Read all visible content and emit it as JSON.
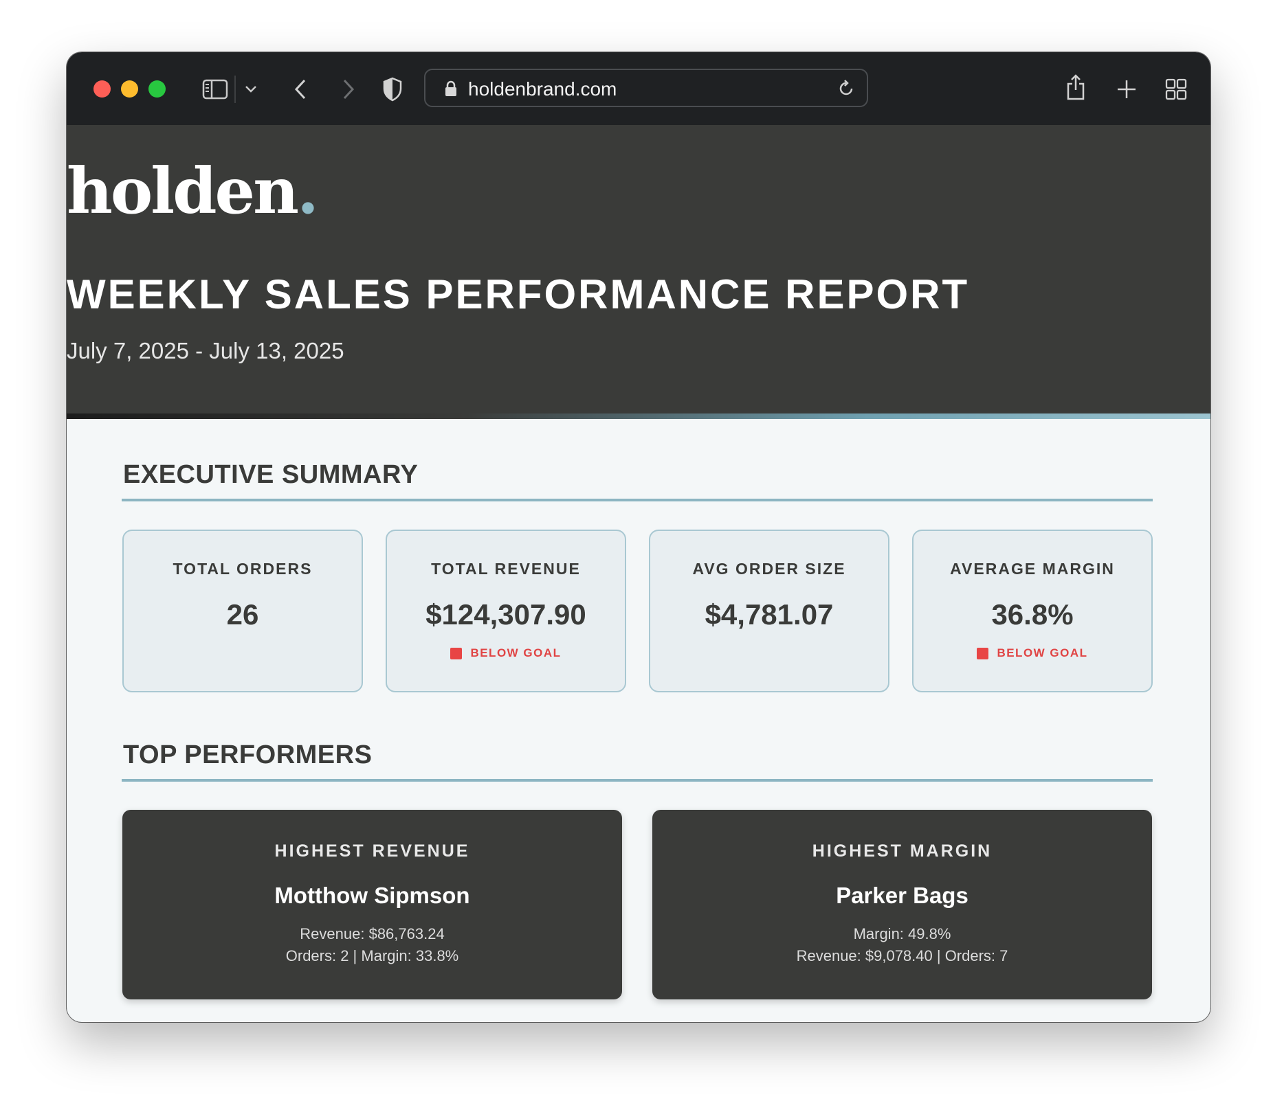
{
  "browser": {
    "url": "holdenbrand.com"
  },
  "brand": {
    "logo_text": "holden",
    "logo_dot": ".",
    "accent_color": "#8fbac6"
  },
  "report": {
    "title": "WEEKLY SALES PERFORMANCE REPORT",
    "date_range": "July 7, 2025 - July 13, 2025"
  },
  "executive_summary": {
    "heading": "EXECUTIVE SUMMARY",
    "cards": [
      {
        "label": "TOTAL ORDERS",
        "value": "26",
        "status": ""
      },
      {
        "label": "TOTAL REVENUE",
        "value": "$124,307.90",
        "status": "BELOW GOAL"
      },
      {
        "label": "AVG ORDER SIZE",
        "value": "$4,781.07",
        "status": ""
      },
      {
        "label": "AVERAGE MARGIN",
        "value": "36.8%",
        "status": "BELOW GOAL"
      }
    ]
  },
  "top_performers": {
    "heading": "TOP PERFORMERS",
    "cards": [
      {
        "label": "HIGHEST REVENUE",
        "name": "Motthow Sipmson",
        "line1": "Revenue: $86,763.24",
        "line2": "Orders: 2 | Margin: 33.8%"
      },
      {
        "label": "HIGHEST MARGIN",
        "name": "Parker Bags",
        "line1": "Margin: 49.8%",
        "line2": "Revenue: $9,078.40 | Orders: 7"
      }
    ]
  },
  "colors": {
    "header_bg": "#3a3b39",
    "alert_red": "#e04444",
    "rule_blue": "#8cb5c2"
  }
}
